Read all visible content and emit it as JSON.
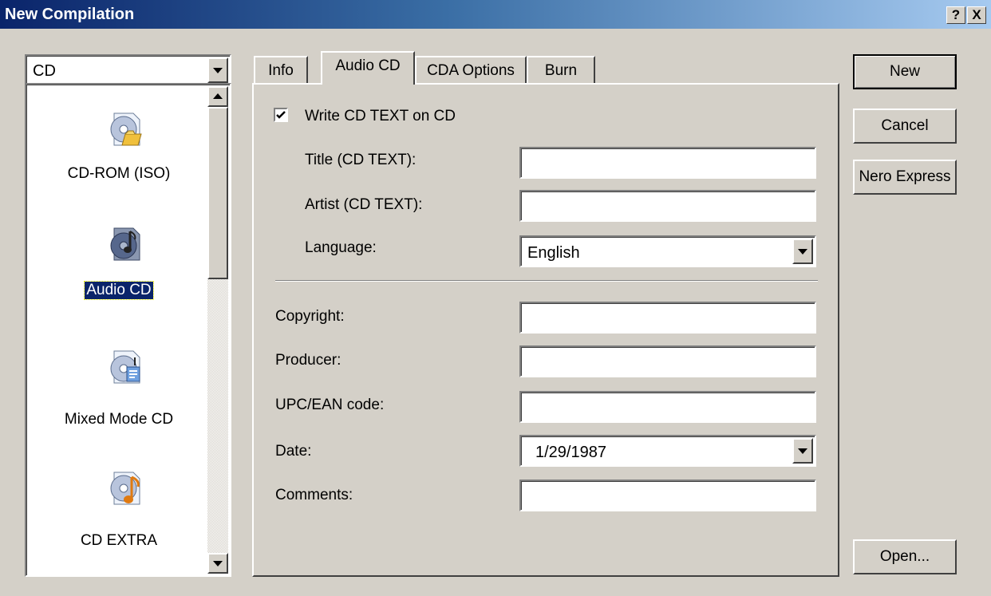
{
  "window": {
    "title": "New Compilation",
    "help_button": "?",
    "close_button": "X"
  },
  "media_combo": {
    "value": "CD"
  },
  "compilation_types": [
    {
      "label": "CD-ROM (ISO)",
      "icon": "cdrom-folder-icon",
      "selected": false
    },
    {
      "label": "Audio CD",
      "icon": "audio-cd-note-icon",
      "selected": true
    },
    {
      "label": "Mixed Mode CD",
      "icon": "mixed-mode-cd-icon",
      "selected": false
    },
    {
      "label": "CD EXTRA",
      "icon": "cd-extra-icon",
      "selected": false
    }
  ],
  "tabs": [
    {
      "label": "Info",
      "active": false
    },
    {
      "label": "Audio CD",
      "active": true
    },
    {
      "label": "CDA Options",
      "active": false
    },
    {
      "label": "Burn",
      "active": false
    }
  ],
  "audio_cd": {
    "write_cd_text": {
      "label": "Write CD TEXT on CD",
      "checked": true
    },
    "title_label": "Title (CD TEXT):",
    "title_value": "",
    "artist_label": "Artist (CD TEXT):",
    "artist_value": "",
    "language_label": "Language:",
    "language_value": "English",
    "copyright_label": "Copyright:",
    "copyright_value": "",
    "producer_label": "Producer:",
    "producer_value": "",
    "upc_label": "UPC/EAN code:",
    "upc_value": "",
    "date_label": "Date:",
    "date_value": "1/29/1987",
    "comments_label": "Comments:",
    "comments_value": ""
  },
  "buttons": {
    "new": "New",
    "cancel": "Cancel",
    "nero_express": "Nero Express",
    "open": "Open..."
  },
  "colors": {
    "face": "#d4d0c8",
    "titlebar_start": "#0a246a",
    "titlebar_end": "#a6caf0",
    "selection": "#0a246a"
  }
}
